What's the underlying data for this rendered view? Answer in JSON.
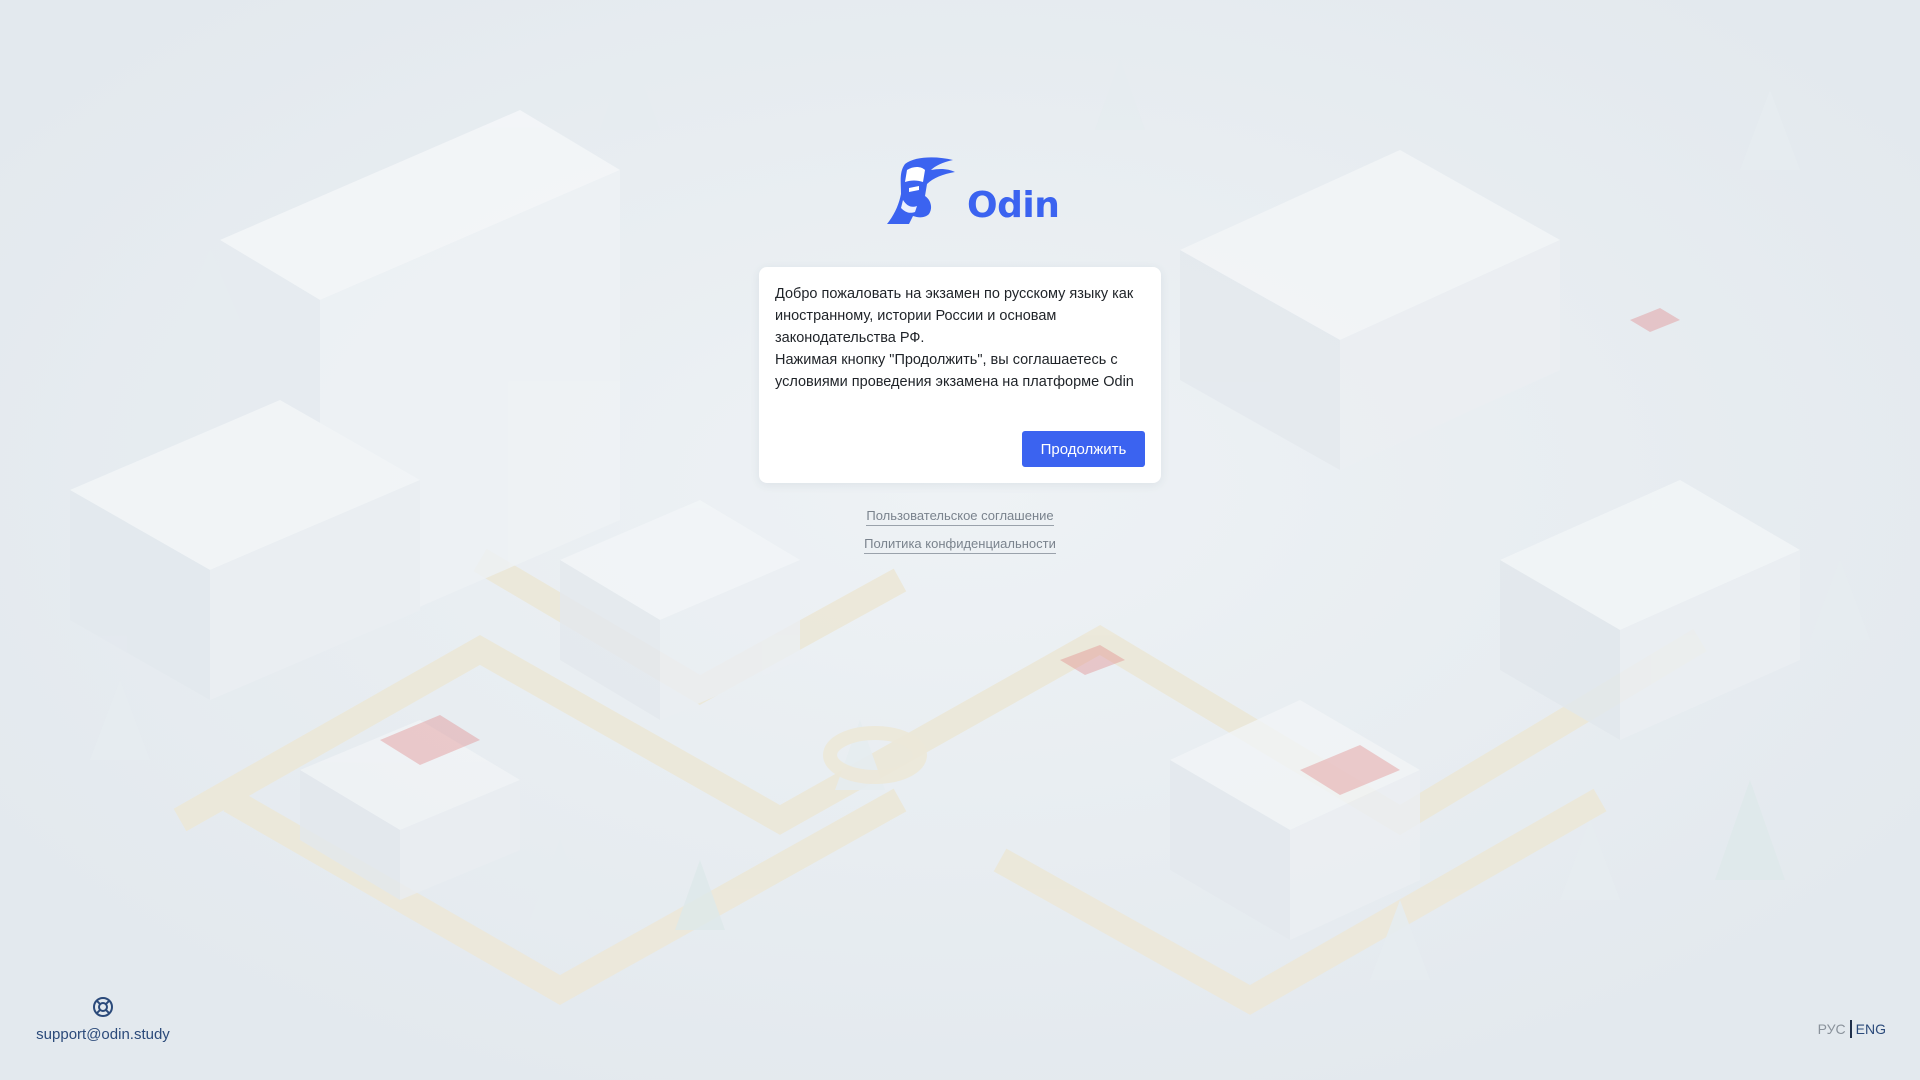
{
  "brand": {
    "name": "Odin",
    "color": "#3b63f0"
  },
  "card": {
    "paragraph1": "Добро пожаловать на экзамен по русскому языку как иностранному, истории России и основам законодательства РФ.",
    "paragraph2": "Нажимая кнопку \"Продолжить\", вы соглашаетесь с условиями проведения экзамена на платформе Odin",
    "continue_label": "Продолжить"
  },
  "links": {
    "user_agreement": "Пользовательское соглашение",
    "privacy_policy": "Политика конфиденциальности"
  },
  "support": {
    "icon": "lifebuoy-icon",
    "email": "support@odin.study"
  },
  "language": {
    "ru": "РУС",
    "en": "ENG",
    "selected": "ENG"
  }
}
